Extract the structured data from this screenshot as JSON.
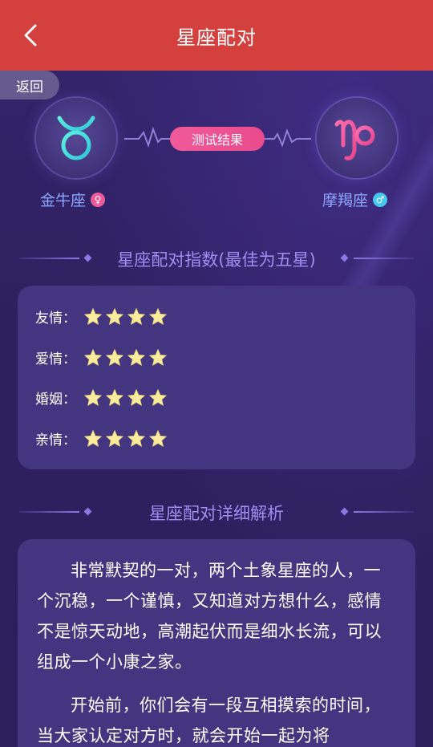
{
  "header": {
    "title": "星座配对"
  },
  "back_label": "返回",
  "match": {
    "left_sign": {
      "name": "金牛座",
      "symbol": "♉",
      "gender": "♀",
      "color": "#3de0d6",
      "gender_color": "#ee5a9a"
    },
    "right_sign": {
      "name": "摩羯座",
      "symbol": "♑",
      "gender": "♂",
      "color": "#f0559d",
      "gender_color": "#47c6ef"
    },
    "result_label": "测试结果"
  },
  "index_section": {
    "title": "星座配对指数(最佳为五星)"
  },
  "ratings": [
    {
      "label": "友情：",
      "stars": 4
    },
    {
      "label": "爱情：",
      "stars": 4
    },
    {
      "label": "婚姻：",
      "stars": 4
    },
    {
      "label": "亲情：",
      "stars": 4
    }
  ],
  "detail_section": {
    "title": "星座配对详细解析"
  },
  "analysis": {
    "paragraphs": [
      "非常默契的一对，两个土象星座的人，一个沉稳，一个谨慎，又知道对方想什么，感情不是惊天动地，高潮起伏而是细水长流，可以组成一个小康之家。",
      "开始前，你们会有一段互相摸索的时间，当大家认定对方时，就会开始一起为将"
    ]
  },
  "colors": {
    "header": "#d3403e",
    "background": "#2f2161",
    "card": "#43357f",
    "accent_pink": "#f05a9a",
    "star": "#fbeb9c"
  }
}
